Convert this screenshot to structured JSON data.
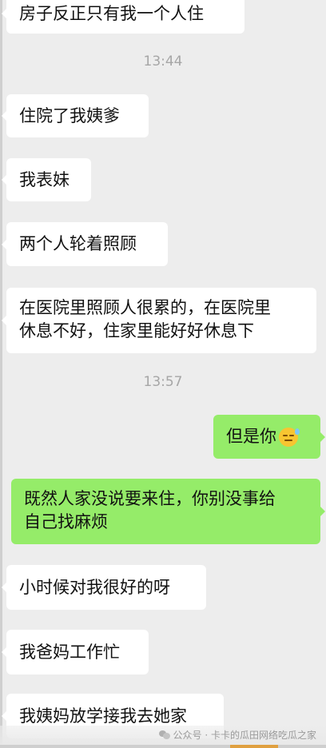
{
  "messages": [
    {
      "side": "in",
      "text": "房子反正只有我一个人住"
    },
    {
      "timestamp": "13:44"
    },
    {
      "side": "in",
      "text": "住院了我姨爹"
    },
    {
      "side": "in",
      "text": "我表妹"
    },
    {
      "side": "in",
      "text": "两个人轮着照顾"
    },
    {
      "side": "in",
      "line1": "在医院里照顾人很累的，在医院里",
      "line2": "休息不好，住家里能好好休息下"
    },
    {
      "timestamp": "13:57"
    },
    {
      "side": "out",
      "text": "但是你",
      "emoji": "sweat-smile-emoji"
    },
    {
      "side": "out",
      "line1": "既然人家没说要来住，你别没事给",
      "line2": "自己找麻烦"
    },
    {
      "side": "in",
      "text": "小时候对我很好的呀"
    },
    {
      "side": "in",
      "text": "我爸妈工作忙"
    },
    {
      "side": "in",
      "text": "我姨妈放学接我去她家"
    }
  ],
  "watermark": {
    "icon": "wechat-icon",
    "text": "公众号 · 卡卡的瓜田网络吃瓜之家"
  },
  "colors": {
    "background": "#ededed",
    "incoming_bubble": "#ffffff",
    "outgoing_bubble": "#95ec69",
    "timestamp": "#a6a6a6"
  }
}
